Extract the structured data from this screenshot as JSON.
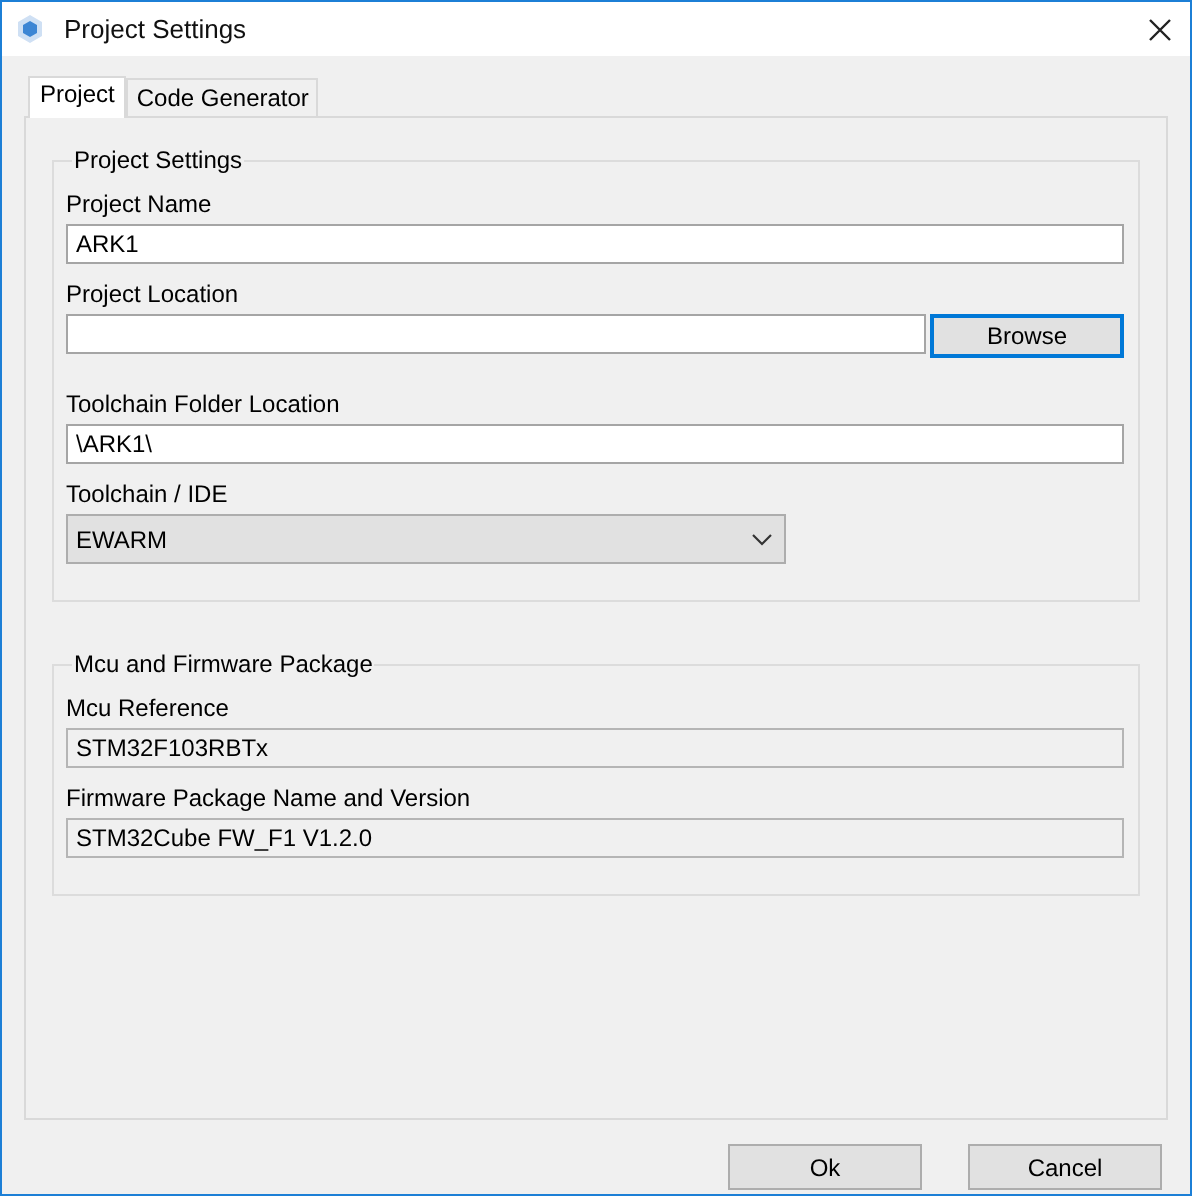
{
  "window": {
    "title": "Project Settings"
  },
  "tabs": [
    {
      "label": "Project",
      "selected": true
    },
    {
      "label": "Code Generator",
      "selected": false
    }
  ],
  "groups": [
    {
      "title": "Project Settings",
      "fields": [
        {
          "kind": "text",
          "label": "Project Name",
          "value": "ARK1"
        },
        {
          "kind": "text",
          "label": "Project Location",
          "button": {
            "label": "Browse",
            "focused": true
          }
        },
        {
          "kind": "text",
          "label": "Toolchain Folder Location",
          "value": "\\ARK1\\"
        },
        {
          "kind": "combo",
          "label": "Toolchain / IDE",
          "value": "EWARM"
        }
      ]
    },
    {
      "title": "Mcu and Firmware Package",
      "fields": [
        {
          "kind": "readonly",
          "label": "Mcu Reference",
          "value": "STM32F103RBTx"
        },
        {
          "kind": "readonly",
          "label": "Firmware Package Name and Version",
          "value": "STM32Cube FW_F1 V1.2.0"
        }
      ]
    }
  ],
  "buttons": [
    "Ok",
    "Cancel"
  ]
}
